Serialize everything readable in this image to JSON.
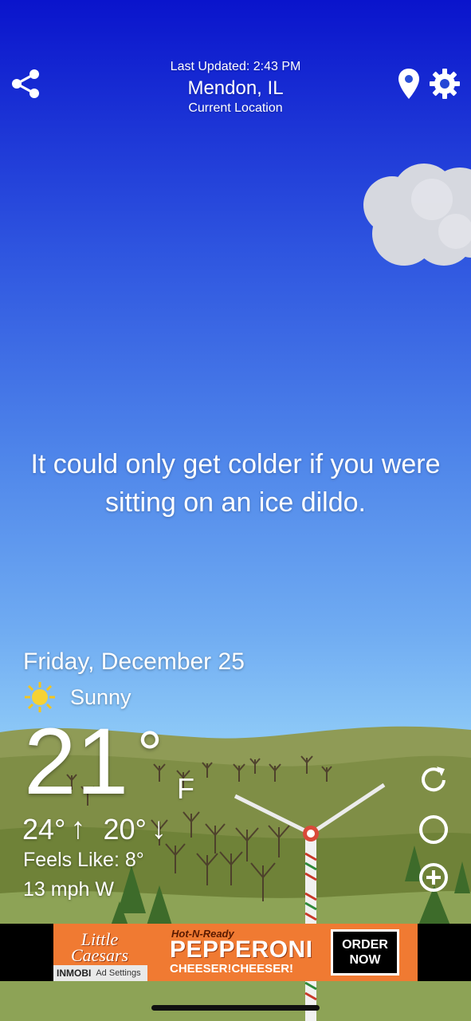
{
  "header": {
    "last_updated": "Last Updated: 2:43 PM",
    "location": "Mendon, IL",
    "location_sub": "Current Location",
    "icons": [
      "share-icon",
      "location-pin-icon",
      "gear-icon"
    ]
  },
  "quote": "It could only get colder if you were sitting on an ice dildo.",
  "weather": {
    "date": "Friday, December 25",
    "condition_icon": "sun-icon",
    "condition": "Sunny",
    "temperature": "21",
    "degree": "°",
    "unit": "F",
    "high": "24°",
    "high_arrow": "↑",
    "low": "20°",
    "low_arrow": "↓",
    "feels_like": "Feels Like: 8°",
    "wind": "13 mph W"
  },
  "side_actions": [
    "refresh-icon",
    "moon-phase-icon",
    "add-icon"
  ],
  "ad": {
    "brand": "Little Caesars",
    "tagline_small": "Hot-N-Ready",
    "headline": "PEPPERONI",
    "subline": "CHEESER!CHEESER!",
    "cta_line1": "ORDER",
    "cta_line2": "NOW",
    "network": "INMOBI",
    "settings": "Ad Settings"
  },
  "colors": {
    "sky_top": "#0a14cc",
    "sky_bottom": "#a8d6f6",
    "ad_orange": "#f07a32"
  }
}
